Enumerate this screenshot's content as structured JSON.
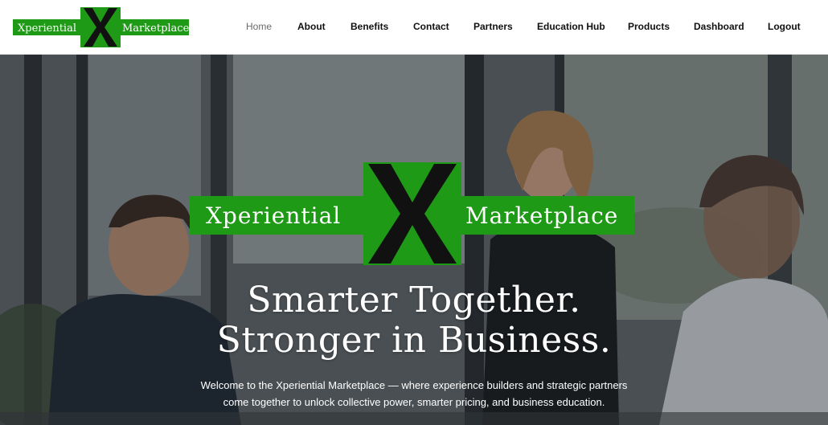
{
  "brand": {
    "left_word": "Xperiential",
    "right_word": "Marketplace",
    "mark": "X",
    "colors": {
      "green": "#1f9a17",
      "black": "#111111",
      "white": "#ffffff"
    }
  },
  "nav": {
    "items": [
      {
        "label": "Home",
        "active": true
      },
      {
        "label": "About"
      },
      {
        "label": "Benefits"
      },
      {
        "label": "Contact"
      },
      {
        "label": "Partners"
      },
      {
        "label": "Education Hub"
      },
      {
        "label": "Products"
      },
      {
        "label": "Dashboard"
      },
      {
        "label": "Logout"
      }
    ]
  },
  "hero": {
    "headline_line1": "Smarter Together.",
    "headline_line2": "Stronger in Business.",
    "intro_line1": "Welcome to the Xperiential Marketplace — where experience builders and strategic partners",
    "intro_line2": "come together to unlock collective power, smarter pricing, and business education."
  }
}
